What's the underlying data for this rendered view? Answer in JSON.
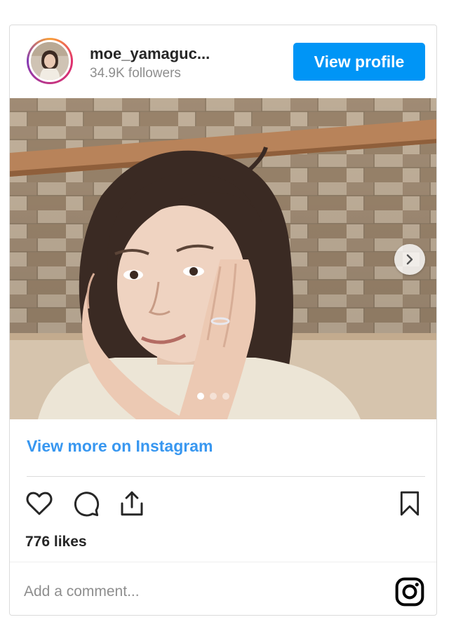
{
  "header": {
    "username": "moe_yamaguc...",
    "followers": "34.9K followers",
    "view_profile_label": "View profile"
  },
  "carousel": {
    "slide_count": 3,
    "active_slide": 1
  },
  "view_more_label": "View more on Instagram",
  "likes_text": "776 likes",
  "comment": {
    "placeholder": "Add a comment..."
  },
  "icons": {
    "heart": "heart-icon",
    "comment": "comment-icon",
    "share": "share-icon",
    "bookmark": "bookmark-icon",
    "instagram": "instagram-logo-icon",
    "next": "chevron-right-icon"
  },
  "colors": {
    "accent": "#0095f6",
    "link": "#3897f0",
    "text": "#262626",
    "muted": "#8e8e8e",
    "border": "#dbdbdb"
  }
}
